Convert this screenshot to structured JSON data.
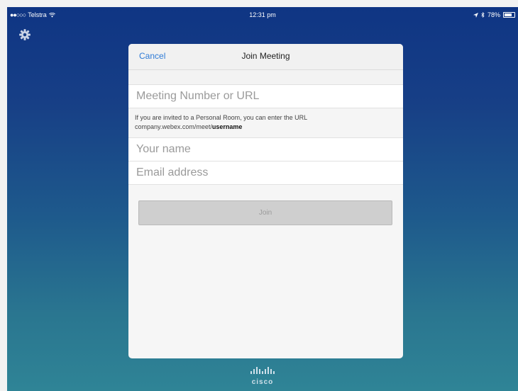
{
  "status_bar": {
    "signal_dots": "●●○○○",
    "carrier": "Telstra",
    "wifi_icon": "wifi-icon",
    "time": "12:31 pm",
    "location_icon": "location-arrow-icon",
    "bluetooth_icon": "bluetooth-icon",
    "battery_percent": "78%",
    "battery_level": 0.78
  },
  "settings": {
    "icon": "gear-icon"
  },
  "modal": {
    "cancel_label": "Cancel",
    "title": "Join Meeting",
    "meeting_field": {
      "placeholder": "Meeting Number or URL",
      "value": ""
    },
    "hint_line1": "If you are invited to a Personal Room, you can enter the URL",
    "hint_url_prefix": "company.webex.com/meet/",
    "hint_url_bold": "username",
    "name_field": {
      "placeholder": "Your name",
      "value": ""
    },
    "email_field": {
      "placeholder": "Email address",
      "value": ""
    },
    "join_label": "Join"
  },
  "footer": {
    "logo_icon": "cisco-logo-icon",
    "logo_text": "cisco"
  },
  "colors": {
    "accent": "#2f7bd6",
    "background_top": "#0f3584",
    "background_bottom": "#2f8496",
    "join_disabled": "#cfcfcf"
  }
}
